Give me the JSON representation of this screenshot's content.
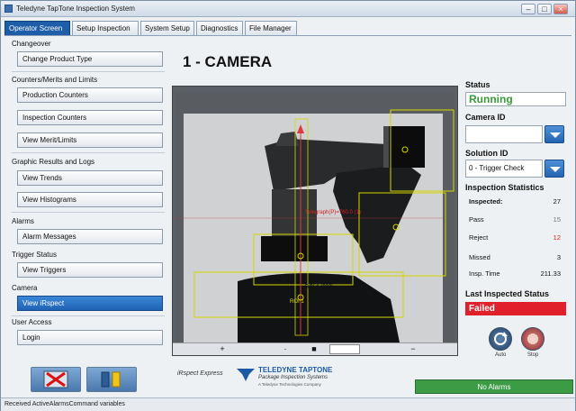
{
  "window": {
    "title": "Teledyne TapTone Inspection System"
  },
  "tabs": [
    {
      "label": "Operator Screen",
      "active": true
    },
    {
      "label": "Setup Inspection"
    },
    {
      "label": "System Setup"
    },
    {
      "label": "Diagnostics"
    },
    {
      "label": "File Manager"
    }
  ],
  "sidebar": {
    "changeover": {
      "title": "Changeover",
      "buttons": [
        "Change Product Type"
      ]
    },
    "counters": {
      "title": "Counters/Merits and Limits",
      "buttons": [
        "Production Counters",
        "Inspection Counters",
        "View Merit/Limits"
      ]
    },
    "graphic": {
      "title": "Graphic Results and Logs",
      "buttons": [
        "View Trends",
        "View Histograms"
      ]
    },
    "alarms": {
      "title": "Alarms",
      "buttons": [
        "Alarm Messages"
      ]
    },
    "trigger": {
      "title": "Trigger Status",
      "buttons": [
        "View Triggers"
      ]
    },
    "camera": {
      "title": "Camera",
      "buttons": [
        "View iRspect"
      ]
    },
    "user_access": {
      "title": "User Access",
      "buttons": [
        "Login"
      ]
    }
  },
  "main": {
    "heading": "1 - CAMERA",
    "viewer": {
      "overlay_texts": {
        "t1": "Telegraph(P)=760.0  (1)",
        "t2": "ROI 1  (300)",
        "t3": "ROI 1"
      },
      "toolbar": {
        "plus": "+",
        "dot1": "·",
        "stop": "■",
        "minus": "−"
      }
    },
    "brand": {
      "left": "iRspect Express",
      "name": "TELEDYNE TAPTONE",
      "tagline": "Package Inspection Systems",
      "sub": "A Teledyne Technologies Company"
    }
  },
  "right_panel": {
    "status_label": "Status",
    "status_value": "Running",
    "camera_id_label": "Camera ID",
    "camera_id_value": "",
    "solution_id_label": "Solution ID",
    "solution_id_value": "0 - Trigger Check",
    "stats_label": "Inspection Statistics",
    "stats": [
      {
        "key": "Inspected:",
        "value": "27"
      },
      {
        "key": "Pass",
        "value": "15"
      },
      {
        "key": "Reject",
        "value": "12"
      },
      {
        "key": "Missed",
        "value": "3"
      },
      {
        "key": "Insp. Time",
        "value": "211.33"
      }
    ],
    "last_status_label": "Last Inspected Status",
    "last_status_value": "Failed",
    "buttons": {
      "auto": "Auto",
      "stop": "Stop"
    }
  },
  "alarm_status": "No Alarms",
  "statusbar": {
    "text": "Received ActiveAlarmsCommand variables"
  },
  "colors": {
    "tab_active": "#1e5ea8",
    "running": "#3a9a3a",
    "failed": "#e0202a",
    "no_alarms": "#3c9b45"
  }
}
